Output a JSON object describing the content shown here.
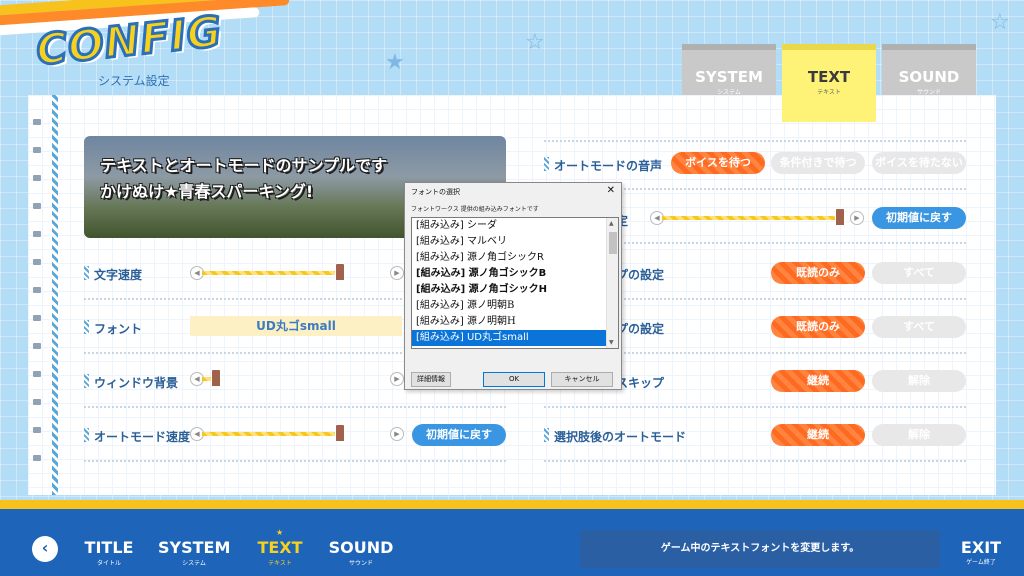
{
  "header": {
    "logo_text": "CONFIG",
    "subtitle": "システム設定"
  },
  "tabs": [
    {
      "label": "SYSTEM",
      "sub": "システム"
    },
    {
      "label": "TEXT",
      "sub": "テキスト"
    },
    {
      "label": "SOUND",
      "sub": "サウンド"
    }
  ],
  "sample": {
    "line1": "テキストとオートモードのサンプルです",
    "line2": "かけぬけ★青春スパーキング!"
  },
  "left_rows": {
    "text_speed": {
      "label": "文字速度",
      "value_fraction": 0.74
    },
    "font": {
      "label": "フォント",
      "value": "UD丸ゴsmall"
    },
    "window_bg": {
      "label": "ウィンドウ背景",
      "value_fraction": 0.05
    },
    "auto_speed": {
      "label": "オートモード速度",
      "value_fraction": 0.74,
      "reset": "初期値に戻す"
    }
  },
  "right_rows": {
    "auto_voice": {
      "label": "オートモードの音声",
      "options": [
        "ボイスを待つ",
        "条件付きで待つ",
        "ボイスを待たない"
      ],
      "selected": 0
    },
    "row2": {
      "label": "定",
      "value_fraction": 0.96,
      "reset": "初期値に戻す"
    },
    "row3": {
      "label": "プの設定",
      "options": [
        "既読のみ",
        "すべて"
      ],
      "selected": 0
    },
    "row4": {
      "label": "プの設定",
      "options": [
        "既読のみ",
        "すべて"
      ],
      "selected": 0
    },
    "row5": {
      "label": "スキップ",
      "options": [
        "継続",
        "解除"
      ],
      "selected": 0
    },
    "after_choice": {
      "label": "選択肢後のオートモード",
      "options": [
        "継続",
        "解除"
      ],
      "selected": 0
    }
  },
  "dialog": {
    "title": "フォントの選択",
    "close": "✕",
    "description": "フォントワークス 提供の組み込みフォントです",
    "items": [
      {
        "text": "[組み込み] シーダ",
        "style": "normal"
      },
      {
        "text": "[組み込み] マルベリ",
        "style": "normal"
      },
      {
        "text": "[組み込み] 源ノ角ゴシックR",
        "style": "normal"
      },
      {
        "text": "[組み込み] 源ノ角ゴシックB",
        "style": "bold"
      },
      {
        "text": "[組み込み] 源ノ角ゴシックH",
        "style": "bold"
      },
      {
        "text": "[組み込み] 源ノ明朝B",
        "style": "serif"
      },
      {
        "text": "[組み込み] 源ノ明朝H",
        "style": "serif"
      },
      {
        "text": "[組み込み] UD丸ゴsmall",
        "style": "selected"
      }
    ],
    "buttons": {
      "details": "詳細情報",
      "ok": "OK",
      "cancel": "キャンセル"
    }
  },
  "footer": {
    "nav": [
      {
        "label": "TITLE",
        "sub": "タイトル"
      },
      {
        "label": "SYSTEM",
        "sub": "システム"
      },
      {
        "label": "TEXT",
        "sub": "テキスト"
      },
      {
        "label": "SOUND",
        "sub": "サウンド"
      }
    ],
    "status": "ゲーム中のテキストフォントを変更します。",
    "exit": {
      "label": "EXIT",
      "sub": "ゲーム終了"
    },
    "back": "‹"
  },
  "colors": {
    "accent": "#ff6a22",
    "brand_blue": "#1e64b9",
    "active_yellow": "#f7d11e"
  }
}
